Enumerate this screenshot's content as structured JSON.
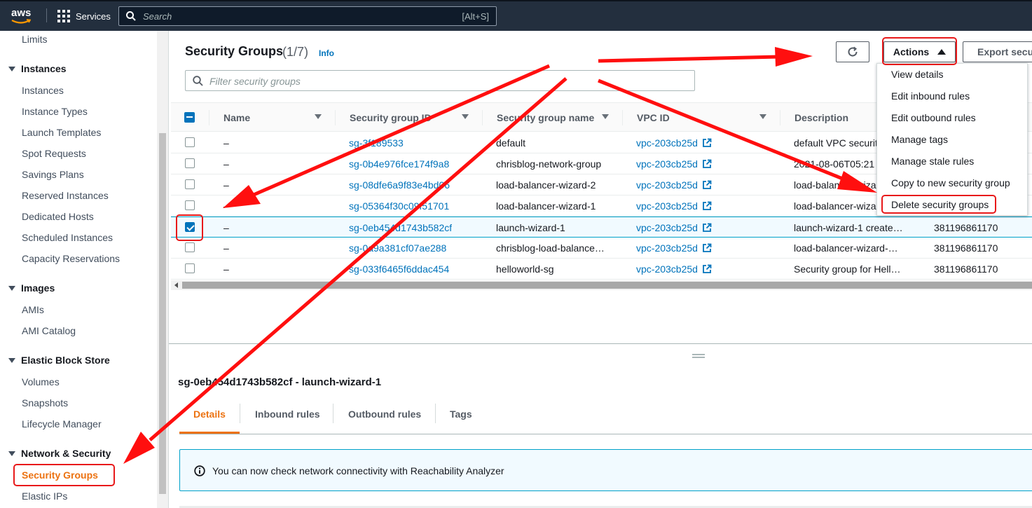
{
  "topnav": {
    "logo_text": "aws",
    "services_label": "Services",
    "search_placeholder": "Search",
    "search_shortcut": "[Alt+S]"
  },
  "sidebar": {
    "items": [
      {
        "label": "Limits",
        "type": "item"
      },
      {
        "label": "Instances",
        "type": "section"
      },
      {
        "label": "Instances",
        "type": "item"
      },
      {
        "label": "Instance Types",
        "type": "item"
      },
      {
        "label": "Launch Templates",
        "type": "item"
      },
      {
        "label": "Spot Requests",
        "type": "item"
      },
      {
        "label": "Savings Plans",
        "type": "item"
      },
      {
        "label": "Reserved Instances",
        "type": "item"
      },
      {
        "label": "Dedicated Hosts",
        "type": "item"
      },
      {
        "label": "Scheduled Instances",
        "type": "item"
      },
      {
        "label": "Capacity Reservations",
        "type": "item"
      },
      {
        "label": "Images",
        "type": "section"
      },
      {
        "label": "AMIs",
        "type": "item"
      },
      {
        "label": "AMI Catalog",
        "type": "item"
      },
      {
        "label": "Elastic Block Store",
        "type": "section"
      },
      {
        "label": "Volumes",
        "type": "item"
      },
      {
        "label": "Snapshots",
        "type": "item"
      },
      {
        "label": "Lifecycle Manager",
        "type": "item"
      },
      {
        "label": "Network & Security",
        "type": "section"
      },
      {
        "label": "Security Groups",
        "type": "active"
      },
      {
        "label": "Elastic IPs",
        "type": "item"
      }
    ]
  },
  "page": {
    "title": "Security Groups",
    "count": "(1/7)",
    "info_label": "Info",
    "actions_label": "Actions",
    "export_label": "Export secu",
    "filter_placeholder": "Filter security groups"
  },
  "table": {
    "columns": [
      "Name",
      "Security group ID",
      "Security group name",
      "VPC ID",
      "Description"
    ],
    "rows": [
      {
        "name": "–",
        "sg_id": "sg-3f189533",
        "sg_name": "default",
        "vpc": "vpc-203cb25d",
        "desc": "default VPC securit",
        "owner": "",
        "selected": false
      },
      {
        "name": "–",
        "sg_id": "sg-0b4e976fce174f9a8",
        "sg_name": "chrisblog-network-group",
        "vpc": "vpc-203cb25d",
        "desc": "2021-08-06T05:21",
        "owner": "",
        "selected": false
      },
      {
        "name": "–",
        "sg_id": "sg-08dfe6a9f83e4bd06",
        "sg_name": "load-balancer-wizard-2",
        "vpc": "vpc-203cb25d",
        "desc": "load-balancer-wiza",
        "owner": "",
        "selected": false
      },
      {
        "name": "–",
        "sg_id": "sg-05364f30c09f51701",
        "sg_name": "load-balancer-wizard-1",
        "vpc": "vpc-203cb25d",
        "desc": "load-balancer-wiza",
        "owner": "",
        "selected": false
      },
      {
        "name": "–",
        "sg_id": "sg-0eb454d1743b582cf",
        "sg_name": "launch-wizard-1",
        "vpc": "vpc-203cb25d",
        "desc": "launch-wizard-1 create…",
        "owner": "381196861170",
        "selected": true
      },
      {
        "name": "–",
        "sg_id": "sg-0a9a381cf07ae288",
        "sg_name": "chrisblog-load-balance…",
        "vpc": "vpc-203cb25d",
        "desc": "load-balancer-wizard-…",
        "owner": "381196861170",
        "selected": false
      },
      {
        "name": "–",
        "sg_id": "sg-033f6465f6ddac454",
        "sg_name": "helloworld-sg",
        "vpc": "vpc-203cb25d",
        "desc": "Security group for Hell…",
        "owner": "381196861170",
        "selected": false
      }
    ]
  },
  "actions_menu": {
    "items": [
      "View details",
      "Edit inbound rules",
      "Edit outbound rules",
      "Manage tags",
      "Manage stale rules",
      "Copy to new security group",
      "Delete security groups"
    ]
  },
  "details": {
    "title": "sg-0eb454d1743b582cf - launch-wizard-1",
    "tabs": [
      "Details",
      "Inbound rules",
      "Outbound rules",
      "Tags"
    ],
    "banner": "You can now check network connectivity with Reachability Analyzer"
  },
  "colors": {
    "nav_bg": "#232f3e",
    "accent": "#ec7211",
    "link": "#0073bb",
    "annotation": "#e8191a"
  }
}
